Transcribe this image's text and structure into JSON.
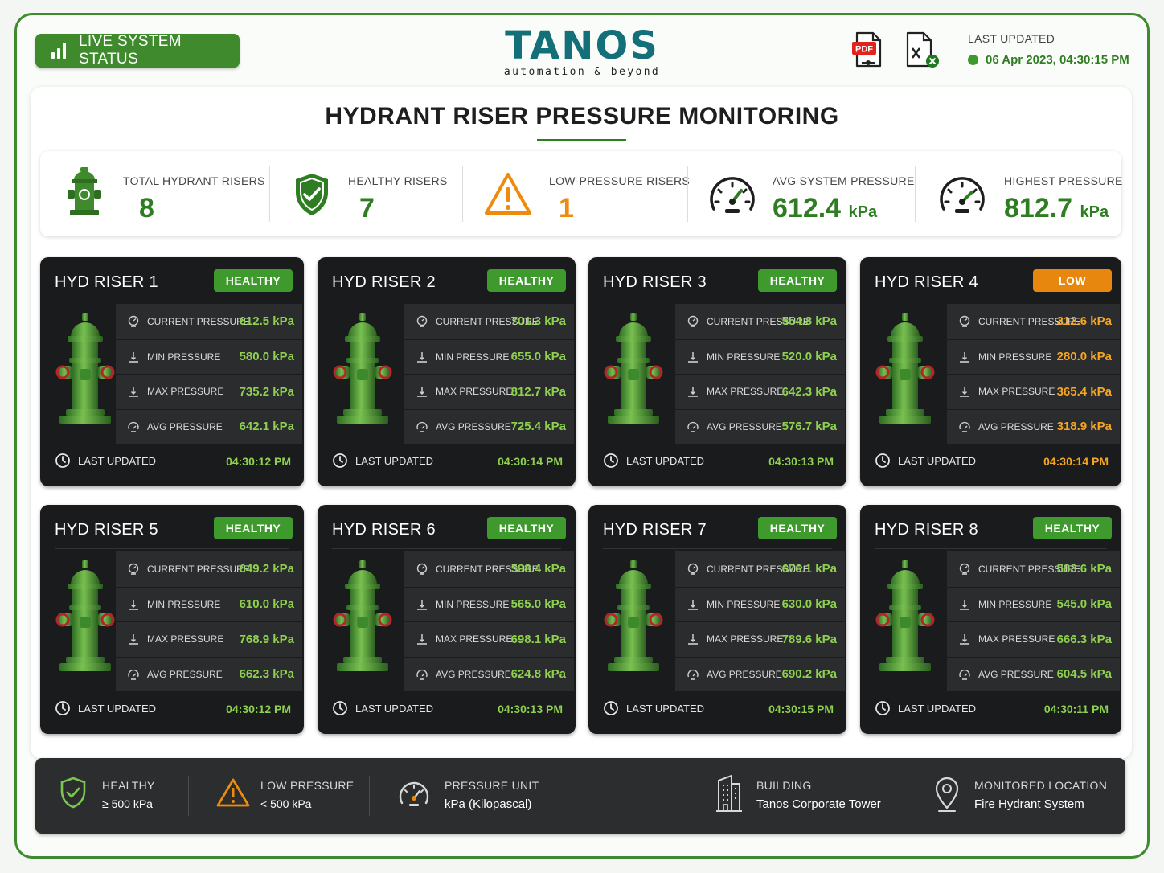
{
  "header": {
    "live_status": "LIVE SYSTEM STATUS",
    "logo_word": "TANOS",
    "logo_tag": "automation & beyond",
    "pdf_label": "PDF",
    "last_updated_label": "LAST UPDATED",
    "last_updated_value": "06 Apr 2023, 04:30:15 PM"
  },
  "title": "HYDRANT RISER PRESSURE MONITORING",
  "summary": {
    "total": {
      "label": "TOTAL HYDRANT RISERS",
      "value": "8"
    },
    "healthy": {
      "label": "HEALTHY RISERS",
      "value": "7"
    },
    "low": {
      "label": "LOW-PRESSURE RISERS",
      "value": "1"
    },
    "avg": {
      "label": "AVG SYSTEM PRESSURE",
      "value": "612.4",
      "unit": "kPa"
    },
    "highest": {
      "label": "HIGHEST PRESSURE",
      "value": "812.7",
      "unit": "kPa"
    }
  },
  "metric_labels": {
    "current": "CURRENT PRESSURE",
    "min": "MIN PRESSURE",
    "max": "MAX PRESSURE",
    "avg": "AVG PRESSURE",
    "last_updated": "LAST UPDATED"
  },
  "colors": {
    "green": "#8fd14f",
    "orange": "#f5a623",
    "badge_green": "#3e9a2c",
    "badge_orange": "#e8870e"
  },
  "risers": [
    {
      "name": "HYD RISER 1",
      "status": "HEALTHY",
      "current": "612.5 kPa",
      "min": "580.0 kPa",
      "max": "735.2 kPa",
      "avg": "642.1 kPa",
      "updated": "04:30:12 PM"
    },
    {
      "name": "HYD RISER 2",
      "status": "HEALTHY",
      "current": "701.3 kPa",
      "min": "655.0 kPa",
      "max": "812.7 kPa",
      "avg": "725.4 kPa",
      "updated": "04:30:14 PM"
    },
    {
      "name": "HYD RISER 3",
      "status": "HEALTHY",
      "current": "554.8 kPa",
      "min": "520.0 kPa",
      "max": "642.3 kPa",
      "avg": "576.7 kPa",
      "updated": "04:30:13 PM"
    },
    {
      "name": "HYD RISER 4",
      "status": "LOW",
      "current": "312.6 kPa",
      "min": "280.0 kPa",
      "max": "365.4 kPa",
      "avg": "318.9 kPa",
      "updated": "04:30:14 PM"
    },
    {
      "name": "HYD RISER 5",
      "status": "HEALTHY",
      "current": "649.2 kPa",
      "min": "610.0 kPa",
      "max": "768.9 kPa",
      "avg": "662.3 kPa",
      "updated": "04:30:12 PM"
    },
    {
      "name": "HYD RISER 6",
      "status": "HEALTHY",
      "current": "598.4 kPa",
      "min": "565.0 kPa",
      "max": "698.1 kPa",
      "avg": "624.8 kPa",
      "updated": "04:30:13 PM"
    },
    {
      "name": "HYD RISER 7",
      "status": "HEALTHY",
      "current": "676.1 kPa",
      "min": "630.0 kPa",
      "max": "789.6 kPa",
      "avg": "690.2 kPa",
      "updated": "04:30:15 PM"
    },
    {
      "name": "HYD RISER 8",
      "status": "HEALTHY",
      "current": "583.6 kPa",
      "min": "545.0 kPa",
      "max": "666.3 kPa",
      "avg": "604.5 kPa",
      "updated": "04:30:11 PM"
    }
  ],
  "legend": {
    "healthy": {
      "title": "HEALTHY",
      "desc": "≥ 500 kPa"
    },
    "low": {
      "title": "LOW PRESSURE",
      "desc": "< 500 kPa"
    },
    "unit": {
      "title": "PRESSURE UNIT",
      "desc": "kPa (Kilopascal)"
    },
    "building": {
      "title": "BUILDING",
      "desc": "Tanos Corporate Tower"
    },
    "location": {
      "title": "MONITORED LOCATION",
      "desc": "Fire Hydrant System"
    }
  }
}
